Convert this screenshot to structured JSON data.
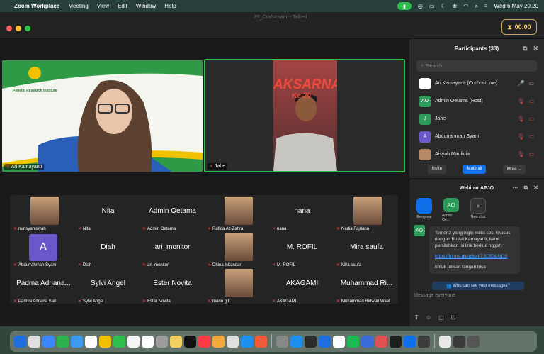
{
  "menubar": {
    "app": "Zoom Workplace",
    "items": [
      "Meeting",
      "View",
      "Edit",
      "Window",
      "Help"
    ],
    "clock": "Wed 6 May  20.20"
  },
  "window": {
    "title": "3S_Orafstorami - Talked",
    "timer": "00:00"
  },
  "main_videos": [
    {
      "label": "Ari Kamayanti",
      "logo_text": "Peneliti Research Institute"
    },
    {
      "label": "Jahe",
      "banner_text": "AKSARNA",
      "banner_sub": "Ke-20"
    }
  ],
  "grid": [
    {
      "name": "",
      "label": "nur syamsiyah",
      "thumb": true
    },
    {
      "name": "Nita",
      "label": "Nita"
    },
    {
      "name": "Admin Oetama",
      "label": "Admin Oetama"
    },
    {
      "name": "",
      "label": "Rafida Az-Zahra",
      "thumb": true
    },
    {
      "name": "nana",
      "label": "nana"
    },
    {
      "name": "",
      "label": "Nadia Fajriana",
      "thumb": true
    },
    {
      "name": "A",
      "label": "Abdurrahman Syani",
      "avatar": true
    },
    {
      "name": "Diah",
      "label": "Diah"
    },
    {
      "name": "ari_monitor",
      "label": "ari_monitor"
    },
    {
      "name": "",
      "label": "Dhina Iskandar",
      "thumb": true
    },
    {
      "name": "M. ROFIL",
      "label": "M. ROFIL"
    },
    {
      "name": "Mira saufa",
      "label": "Mira saufa"
    },
    {
      "name": "Padma Adriana...",
      "label": "Padma Adriana Sari"
    },
    {
      "name": "Sylvi Angel",
      "label": "Sylvi Angel"
    },
    {
      "name": "Ester Novita",
      "label": "Ester Novita"
    },
    {
      "name": "",
      "label": "mario g.t",
      "thumb": true
    },
    {
      "name": "AKAGAMI",
      "label": "AKAGAMI"
    },
    {
      "name": "Muhammad Ri...",
      "label": "Muhammad Ridwan Wael"
    }
  ],
  "participants": {
    "title": "Participants (33)",
    "search_placeholder": "Search",
    "rows": [
      {
        "initial": "",
        "name": "Ari Kamayanti (Co-host, me)",
        "color": "#ffffff"
      },
      {
        "initial": "AO",
        "name": "Admin Oetama (Host)",
        "color": "#2d9b59"
      },
      {
        "initial": "J",
        "name": "Jahe",
        "color": "#2d9b59"
      },
      {
        "initial": "A",
        "name": "Abdurrahman Syani",
        "color": "#6a57c9"
      },
      {
        "initial": "",
        "name": "Aisyah Maulidia",
        "color": "#b78b6a"
      }
    ],
    "invite": "Invite",
    "mute_all": "Mute all",
    "more": "More"
  },
  "chat": {
    "title": "Webinar APJO",
    "tabs": [
      {
        "label": "Everyone",
        "initial": "🐾",
        "color": "#0e71eb"
      },
      {
        "label": "Admin Oe...",
        "initial": "AO",
        "color": "#2d9b59"
      },
      {
        "label": "New chat",
        "initial": "+",
        "color": "#333333"
      }
    ],
    "sender_initial": "AO",
    "message": "Temen2 yang ingin miliki sesi khusus dengan Bu Ari Kamayanti, kami persilahkan isi link berikut nggeh:",
    "link": "https://forms.gle/g5u4i7JC5DjLUDB",
    "message2": "untuk tulisan tangan bisa",
    "who_can_see": "Who can see your messages?",
    "input_placeholder": "Message everyone"
  },
  "colors": {
    "accent": "#0e71eb",
    "muted": "#e34b4b",
    "active_border": "#2dbe4f"
  }
}
